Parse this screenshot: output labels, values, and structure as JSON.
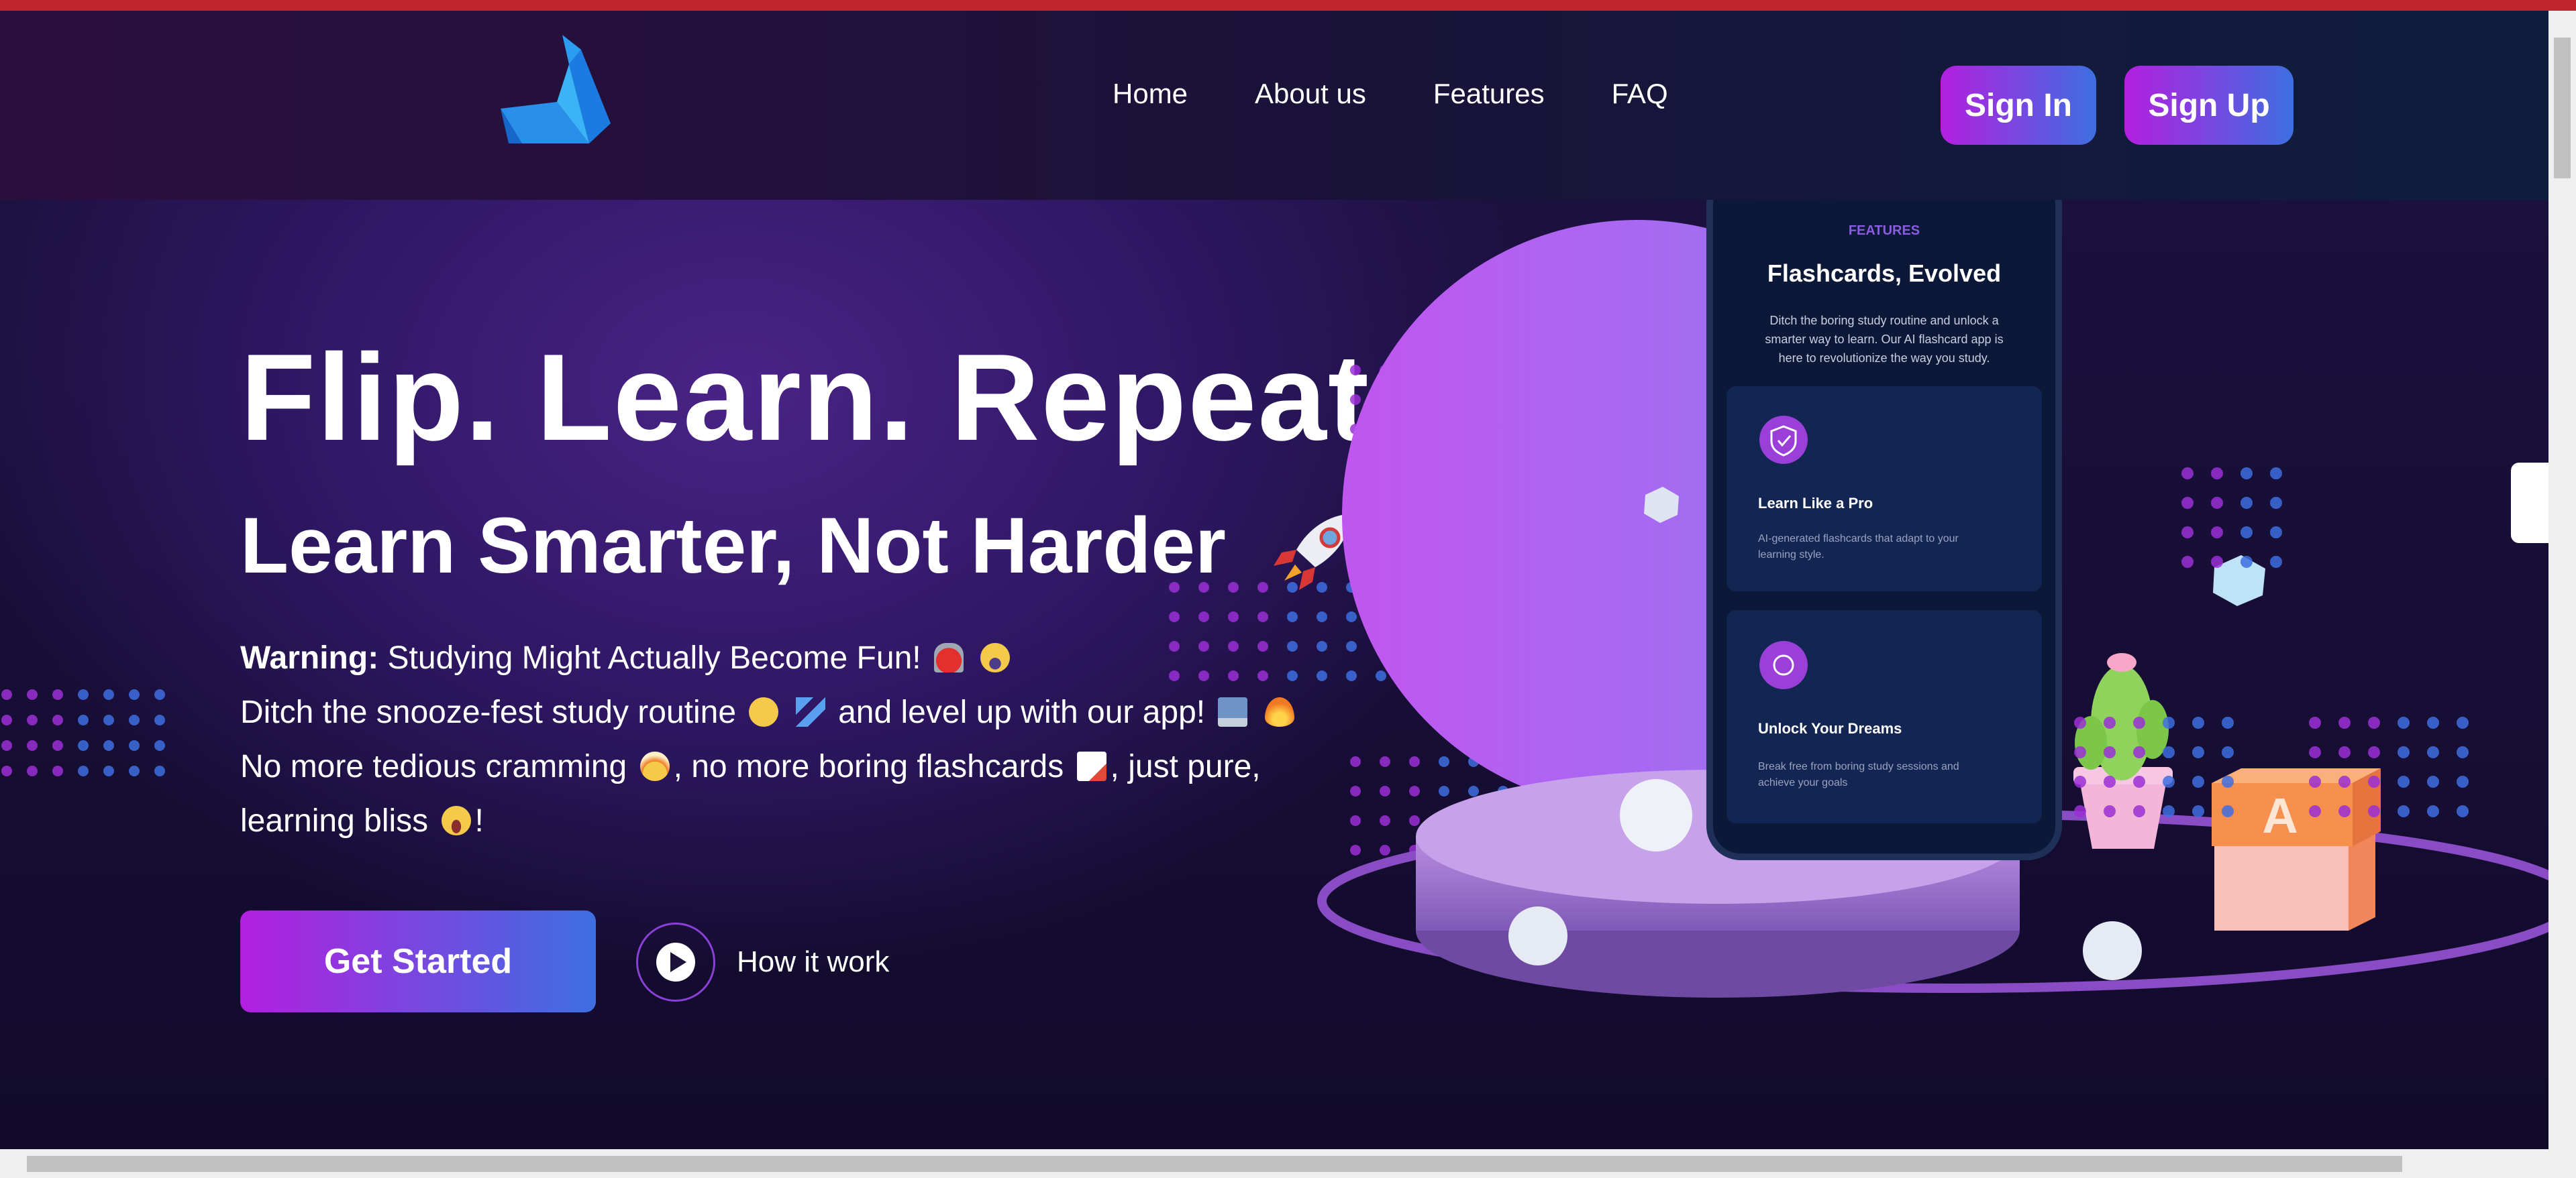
{
  "colors": {
    "accent_start": "#b31fe0",
    "accent_end": "#3d6fe0",
    "page_bg": "#140c2e",
    "top_strip": "#c0272d"
  },
  "nav": {
    "links": [
      "Home",
      "About us",
      "Features",
      "FAQ"
    ],
    "sign_in": "Sign In",
    "sign_up": "Sign Up"
  },
  "hero": {
    "title": "Flip. Learn. Repeat",
    "subtitle": "Learn Smarter, Not Harder",
    "warning_label": "Warning:",
    "warning_text": "Studying Might Actually Become Fun!",
    "line2_a": "Ditch the snooze-fest study routine",
    "line2_b": "and level up with our app!",
    "line3_a": "No more tedious cramming",
    "line3_b": ", no more boring flashcards",
    "line3_c": ", just pure,",
    "line4_a": "learning bliss",
    "line4_b": "!",
    "cta": "Get Started",
    "how_it_works": "How it work"
  },
  "phone": {
    "eyebrow": "FEATURES",
    "title": "Flashcards, Evolved",
    "description_1": "Ditch the boring study routine and unlock a",
    "description_2": "smarter way to learn. Our AI flashcard app is",
    "description_3": "here to revolutionize the way you study.",
    "card1_title": "Learn Like a Pro",
    "card1_text_1": "AI-generated flashcards that adapt to your",
    "card1_text_2": "learning style.",
    "card2_title": "Unlock Your Dreams",
    "card2_text_1": "Break free from boring study sessions and",
    "card2_text_2": "achieve your goals"
  },
  "decor": {
    "block_letter": "A"
  },
  "icons": [
    "logo-bird-icon",
    "rocket-icon",
    "siren-icon",
    "scream-face-icon",
    "sleeping-face-icon",
    "zzz-icon",
    "laptop-icon",
    "fire-icon",
    "exploding-head-icon",
    "memo-icon",
    "laughing-face-icon",
    "play-icon",
    "shield-check-icon",
    "coin-icon"
  ]
}
